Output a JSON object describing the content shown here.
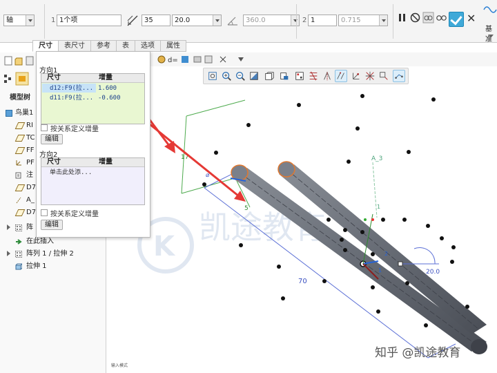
{
  "dashboard": {
    "reference_type": "轴",
    "count_index": "1",
    "count_value": "1个项",
    "angle_value": "35",
    "distance_value": "20.0",
    "second_angle_value": "360.0",
    "second_count_index": "2",
    "second_count_value": "1",
    "second_distance_value": "0.715",
    "datum_label": "基准"
  },
  "tabs": [
    "尺寸",
    "表尺寸",
    "参考",
    "表",
    "选项",
    "属性"
  ],
  "active_tab": "尺寸",
  "popup": {
    "direction1_label": "方向1",
    "direction2_label": "方向2",
    "col_dim": "尺寸",
    "col_inc": "增量",
    "direction1_rows": [
      {
        "dim": "d12:F9(拉...",
        "inc": "1.600"
      },
      {
        "dim": "d11:F9(拉...",
        "inc": "-0.600"
      }
    ],
    "direction2_placeholder": "单击此处添...",
    "define_by_relation": "按关系定义增量",
    "edit_button": "编辑"
  },
  "model_tree": {
    "title": "模型树",
    "items": [
      {
        "label": "鸟巢1",
        "icon": "part-icon"
      },
      {
        "label": "RI",
        "icon": "datum-plane-icon"
      },
      {
        "label": "TC",
        "icon": "datum-plane-icon"
      },
      {
        "label": "FF",
        "icon": "datum-plane-icon"
      },
      {
        "label": "PF",
        "icon": "csys-icon"
      },
      {
        "label": "注",
        "icon": "annotation-icon"
      },
      {
        "label": "D7",
        "icon": "datum-plane-icon"
      },
      {
        "label": "A_",
        "icon": "datum-axis-icon"
      },
      {
        "label": "D7",
        "icon": "datum-plane-icon"
      },
      {
        "label": "阵",
        "icon": "pattern-icon"
      },
      {
        "label": "在此插入",
        "icon": "insert-here-icon"
      },
      {
        "label": "阵列 1 / 拉伸 2",
        "icon": "pattern-icon"
      },
      {
        "label": "拉伸 1",
        "icon": "extrude-icon"
      }
    ]
  },
  "canvas": {
    "dim_length": "70",
    "dim_angle": "20.0",
    "dim_side": "17",
    "axis_label": "A_3",
    "dim_small": "5",
    "marker_1": "2",
    "marker_2": "1",
    "marker_3": "1"
  },
  "status_text": "输入模式",
  "watermark_brand": "凯途教育",
  "watermark_credit": "知乎 @凯途教育",
  "colors": {
    "accent": "#3fa9d8",
    "arrow": "#e53935",
    "rod": "#6a6f78"
  }
}
